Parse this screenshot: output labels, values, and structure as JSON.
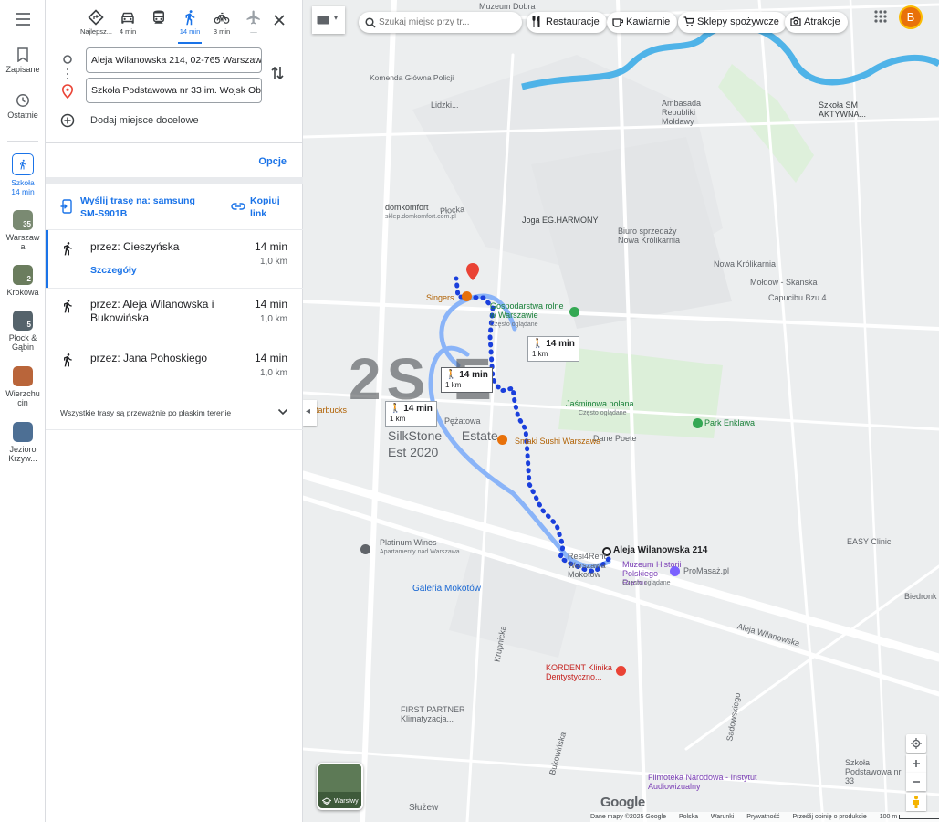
{
  "rail": {
    "saved_label": "Zapisane",
    "recent_label": "Ostatnie",
    "current": {
      "label": "Szkoła",
      "sub": "14 min"
    },
    "history": [
      {
        "label": "Warszaw a",
        "num": "35"
      },
      {
        "label": "Krokowa",
        "num": "2"
      },
      {
        "label": "Płock & Gąbin",
        "num": "5"
      },
      {
        "label": "Wierzchu cin",
        "num": ""
      },
      {
        "label": "Jezioro Krzyw...",
        "num": ""
      }
    ]
  },
  "directions": {
    "modes": [
      {
        "icon": "diamond-route-icon",
        "label": "Najlepsz..."
      },
      {
        "icon": "car-icon",
        "label": "4 min"
      },
      {
        "icon": "train-icon",
        "label": ""
      },
      {
        "icon": "walk-icon",
        "label": "14 min"
      },
      {
        "icon": "bike-icon",
        "label": "3 min"
      },
      {
        "icon": "plane-icon",
        "label": "—"
      }
    ],
    "origin": "Aleja Wilanowska 214, 02-765 Warszawa",
    "destination": "Szkoła Podstawowa nr 33 im. Wojsk Obr...",
    "add_destination": "Dodaj miejsce docelowe",
    "options": "Opcje",
    "send_route": "Wyślij trasę na: samsung SM-S901B",
    "copy_link": "Kopiuj link",
    "routes": [
      {
        "title": "przez: Cieszyńska",
        "duration": "14 min",
        "distance": "1,0 km",
        "details": "Szczegóły"
      },
      {
        "title": "przez: Aleja Wilanowska i Bukowińska",
        "duration": "14 min",
        "distance": "1,0 km"
      },
      {
        "title": "przez: Jana Pohoskiego",
        "duration": "14 min",
        "distance": "1,0 km"
      }
    ],
    "terrain_note": "Wszystkie trasy są przeważnie po płaskim terenie"
  },
  "map": {
    "search_placeholder": "Szukaj miejsc przy tr...",
    "chips": [
      "Restauracje",
      "Kawiarnie",
      "Sklepy spożywcze",
      "Atrakcje"
    ],
    "avatar_letter": "B",
    "accent": "#1a73e8",
    "route_color": "#1a3fdc",
    "labels": {
      "muzeum": "Muzeum Dobra",
      "komenda": "Komenda Główna Policji",
      "lidzki": "Lidzki...",
      "ambasada": "Ambasada Republiki Mołdawy",
      "skm": "Szkoła SM AKTYWNA...",
      "domkomfort": "domkomfort",
      "domkomfort_sub": "sklep.domkomfort.com.pl",
      "joga": "Joga EG.HARMONY",
      "biuro": "Biuro sprzedaży Nowa Królikarnia",
      "nowa": "Nowa Królikarnia",
      "moldow": "Mołdow - Skanska",
      "capucibu": "Capucibu Bzu 4",
      "singers": "Singers",
      "gospodarstwa": "Gospodarstwa rolne w Warszawie",
      "gospodarstwa_sub": "Często oglądane",
      "bg_letters": "2S E",
      "jasminowa": "Jaśminowa polana",
      "jasminowa_sub": "Często oglądane",
      "park": "Park Enklawa",
      "pepe": "Dane Poete",
      "starbucks": "Starbucks",
      "pezatowa": "Pężatowa",
      "silkstone": "SilkStone — Estate",
      "est": "Est 2020",
      "sushi": "Smaki Sushi Warszawa",
      "resi": "Resi4Rent Warszawa Mokotów",
      "resi_sub": "Często oglądane",
      "pin": "Aleja Wilanowska 214",
      "muzeum2": "Muzeum Historii Polskiego Ruchu...",
      "muzeum2_sub": "Często oglądane",
      "promasaz": "ProMasaż.pl",
      "easy": "EASY Clinic",
      "biedronka": "Biedronk",
      "wines": "Platinum Wines",
      "apartamenty": "Apartamenty nad Warszawa",
      "galeria": "Galeria Mokotów",
      "kordent": "KORDENT Klinika Dentystyczno...",
      "firstpartner": "FIRST PARTNER Klimatyzacja...",
      "szkola": "Szkoła Podstawowa nr 33",
      "filmoteka": "Filmoteka Narodowa - Instytut Audiowizualny",
      "sluzew": "Służew",
      "street1": "Krupnicka",
      "street2": "Bukowińska",
      "street3": "Sadowskiego",
      "street4": "Płocka",
      "street5": "Aleja Wilanowska"
    },
    "time_boxes": [
      {
        "time": "14 min",
        "sub": "1 km"
      },
      {
        "time": "14 min",
        "sub": "1 km"
      },
      {
        "time": "14 min",
        "sub": "1 km"
      }
    ],
    "layers_label": "Warstwy",
    "google": "Google",
    "footer": [
      "Dane mapy ©2025 Google",
      "Polska",
      "Warunki",
      "Prywatność",
      "Prześlij opinię o produkcie",
      "100 m"
    ]
  }
}
